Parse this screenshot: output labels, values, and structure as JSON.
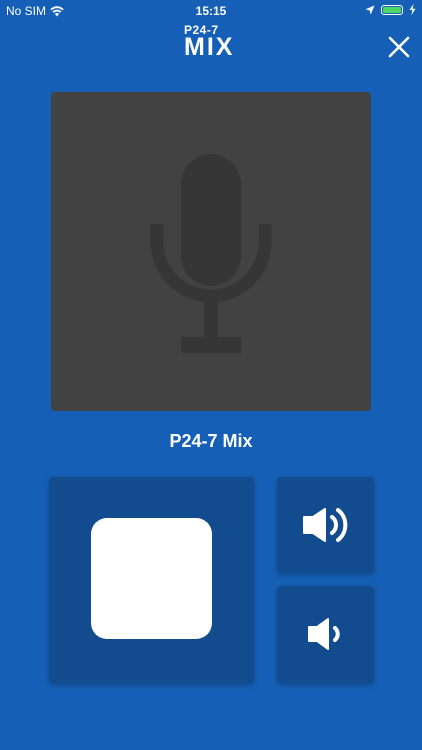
{
  "status_bar": {
    "carrier": "No SIM",
    "time": "15:15",
    "battery_color": "#4cd964"
  },
  "header": {
    "logo_top": "P24-7",
    "logo_bottom": "MIX",
    "close_icon": "close-icon"
  },
  "player": {
    "artwork_icon": "microphone-icon",
    "station_name": "P24-7 Mix"
  },
  "controls": {
    "stop_icon": "stop-icon",
    "volume_up_icon": "volume-up-icon",
    "volume_down_icon": "volume-down-icon"
  },
  "colors": {
    "background": "#1560b6",
    "control_bg": "#134c8e",
    "artwork_bg": "#424242"
  }
}
